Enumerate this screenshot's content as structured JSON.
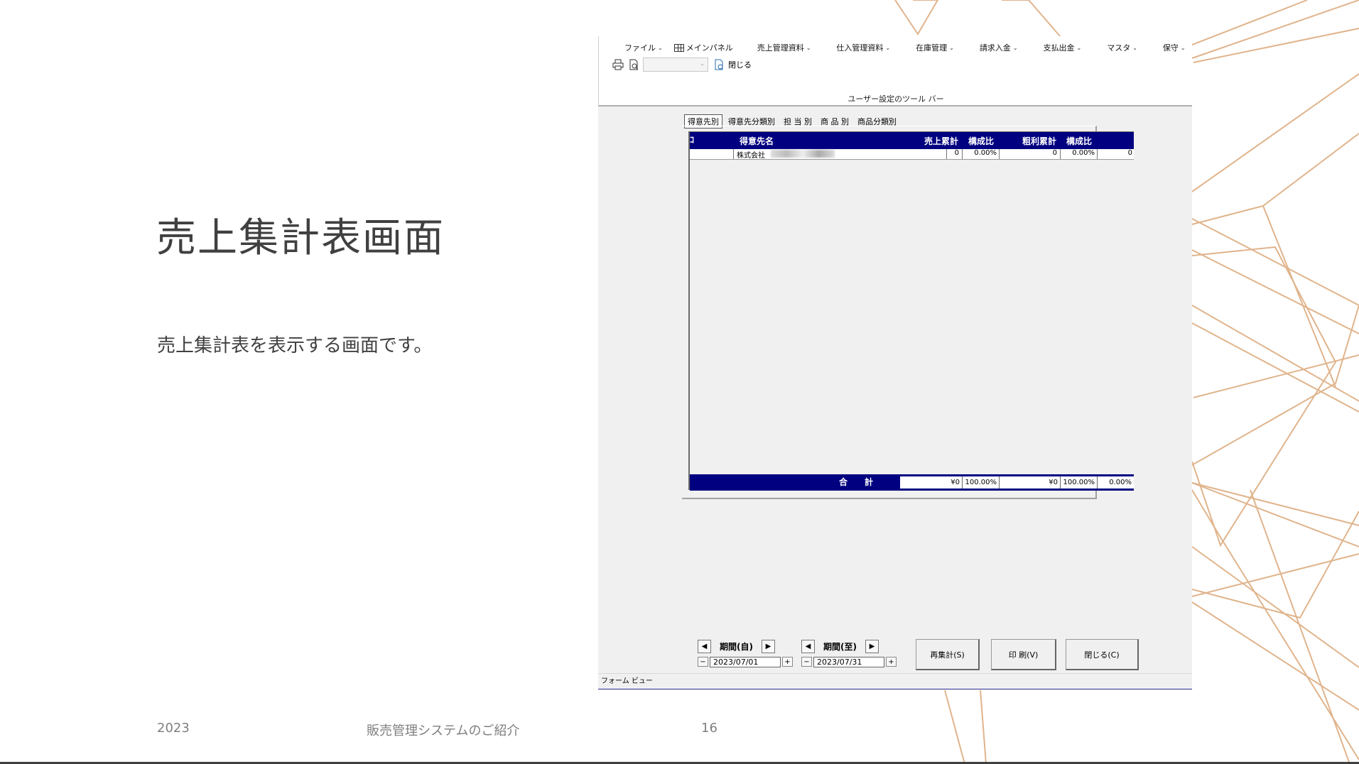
{
  "slide": {
    "title": "売上集計表画面",
    "body": "売上集計表を表示する画面です。",
    "footer_year": "2023",
    "footer_center": "販売管理システムのご紹介",
    "page_number": "16"
  },
  "colors": {
    "decor_line": "#e0b48c",
    "grid_header": "#000080",
    "status_line": "#333399"
  },
  "app": {
    "menu": [
      {
        "label": "ファイル",
        "icon": ""
      },
      {
        "label": "メインパネル",
        "icon": "grid-icon"
      },
      {
        "label": "売上管理資料",
        "icon": ""
      },
      {
        "label": "仕入管理資料",
        "icon": ""
      },
      {
        "label": "在庫管理",
        "icon": ""
      },
      {
        "label": "請求入金",
        "icon": ""
      },
      {
        "label": "支払出金",
        "icon": ""
      },
      {
        "label": "マスタ",
        "icon": ""
      },
      {
        "label": "保守",
        "icon": ""
      }
    ],
    "toolbar": {
      "close_label": "閉じる",
      "combo_value": ""
    },
    "ribbon_caption": "ユーザー設定のツール バー",
    "tabs": [
      {
        "label": "得意先別",
        "active": true
      },
      {
        "label": "得意先分類別",
        "active": false
      },
      {
        "label": "担 当 別",
        "active": false
      },
      {
        "label": "商 品 別",
        "active": false
      },
      {
        "label": "商品分類別",
        "active": false
      }
    ],
    "grid": {
      "headers": {
        "marker": "ｺ",
        "customer": "得意先名",
        "sales_total": "売上累計",
        "ratio1": "構成比",
        "profit_total": "粗利累計",
        "ratio2": "構成比"
      },
      "row": {
        "customer": "株式会社",
        "sales": "0",
        "ratio1": "0.00%",
        "profit": "0",
        "ratio2": "0.00%",
        "extra": "0"
      },
      "footer": {
        "label": "合　　計",
        "sales": "¥0",
        "ratio1": "100.00%",
        "profit": "¥0",
        "ratio2": "100.00%",
        "extra": "0.00%"
      }
    },
    "period_from": {
      "label": "期間(自)",
      "date": "2023/07/01"
    },
    "period_to": {
      "label": "期間(至)",
      "date": "2023/07/31"
    },
    "buttons": {
      "recalc": "再集計(S)",
      "print": "印 刷(V)",
      "close": "閉じる(C)"
    },
    "status": "フォーム ビュー"
  }
}
